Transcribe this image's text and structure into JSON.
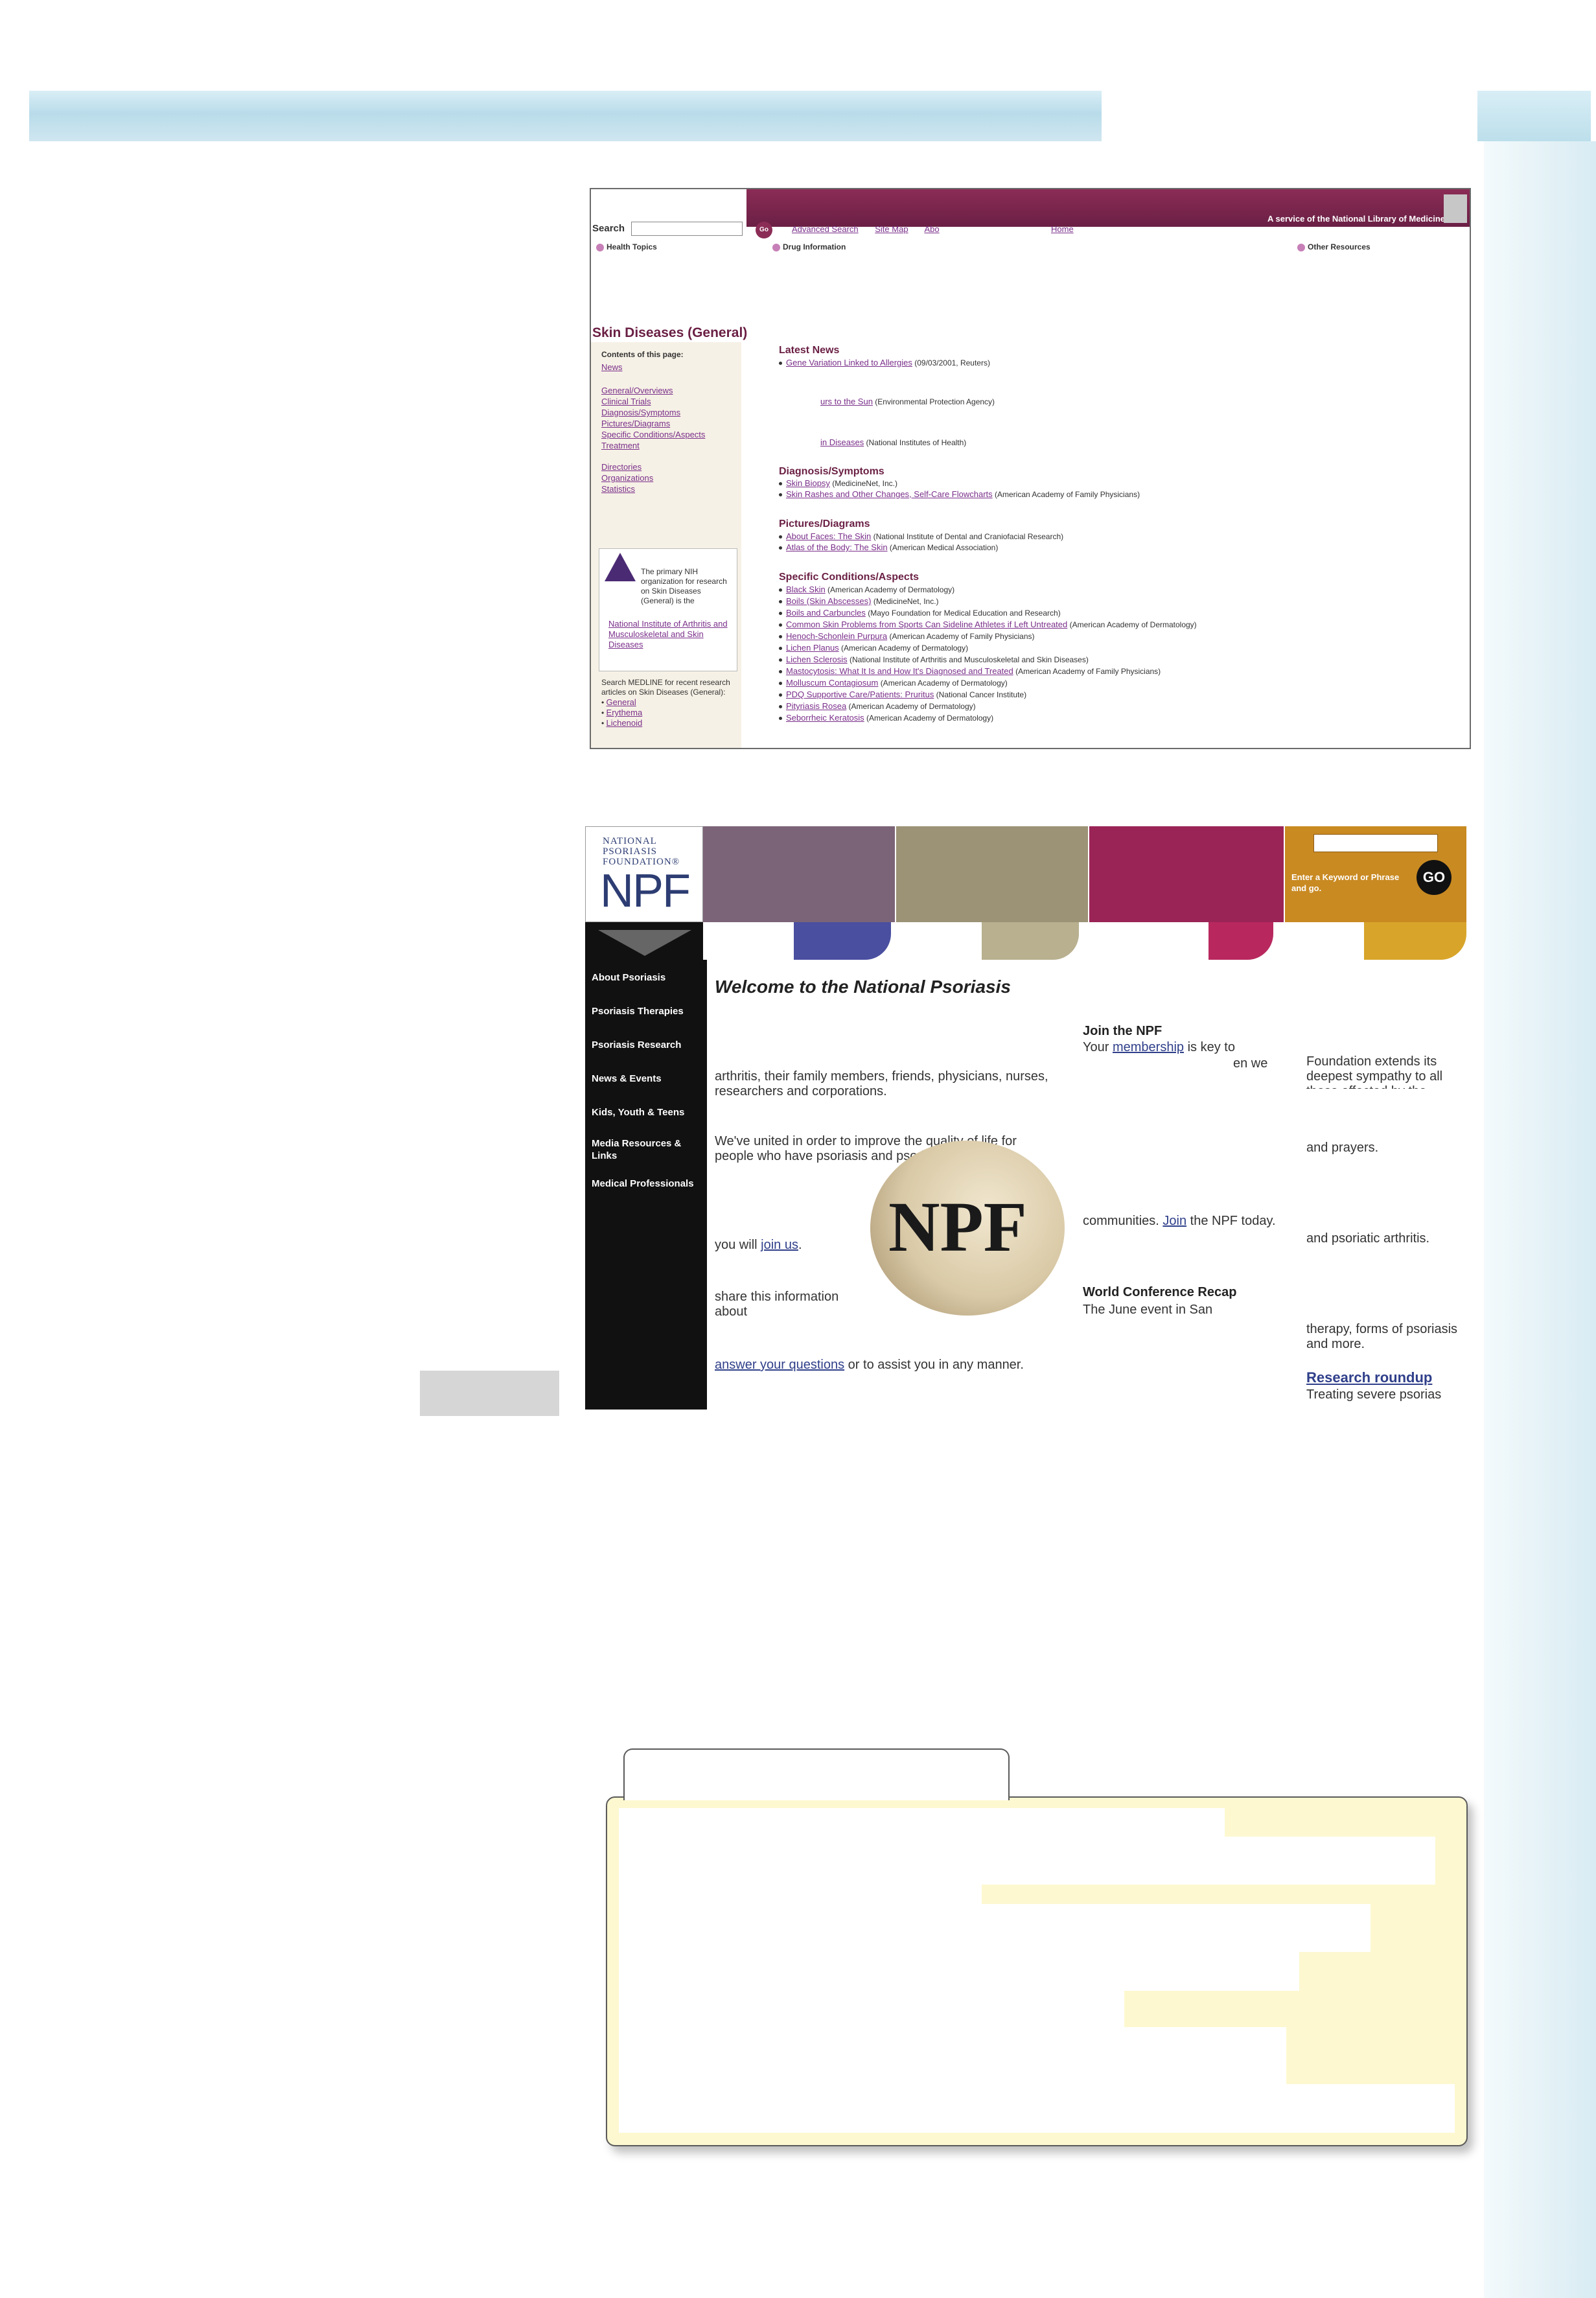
{
  "medline": {
    "banner_text": "A service of the National Library of Medicine",
    "search_label": "Search",
    "go_label": "Go",
    "nav_links": [
      "Advanced Search",
      "Site Map",
      "Abo"
    ],
    "home_link": "Home",
    "tabs": [
      "Health Topics",
      "Drug Information",
      "Other Resources"
    ],
    "page_title": "Skin Diseases (General)",
    "contents_label": "Contents of this page:",
    "side_links_1": [
      "News"
    ],
    "side_links_2": [
      "General/Overviews",
      "Clinical Trials",
      "Diagnosis/Symptoms",
      "Pictures/Diagrams",
      "Specific Conditions/Aspects",
      "Treatment"
    ],
    "side_links_3": [
      "Directories",
      "Organizations",
      "Statistics"
    ],
    "nih_text_1": "The primary NIH organization for research on Skin Diseases (General) is the",
    "nih_link": "National Institute of Arthritis and Musculoskeletal and Skin Diseases",
    "medline_text": "Search MEDLINE for recent research articles on Skin Diseases (General):",
    "medline_links": [
      "General",
      "Erythema",
      "Lichenoid"
    ],
    "sections": [
      {
        "heading": "Latest News",
        "items": [
          {
            "link": "Gene Variation Linked to Allergies",
            "src": "(09/03/2001, Reuters)"
          },
          {
            "link": "urs to the Sun",
            "src": "(Environmental Protection Agency)"
          },
          {
            "link": "in Diseases",
            "src": "(National Institutes of Health)"
          }
        ]
      },
      {
        "heading": "Diagnosis/Symptoms",
        "items": [
          {
            "link": "Skin Biopsy",
            "src": "(MedicineNet, Inc.)"
          },
          {
            "link": "Skin Rashes and Other Changes, Self-Care Flowcharts",
            "src": "(American Academy of Family Physicians)"
          }
        ]
      },
      {
        "heading": "Pictures/Diagrams",
        "items": [
          {
            "link": "About Faces: The Skin",
            "src": "(National Institute of Dental and Craniofacial Research)"
          },
          {
            "link": "Atlas of the Body: The Skin",
            "src": "(American Medical Association)"
          }
        ]
      },
      {
        "heading": "Specific Conditions/Aspects",
        "items": [
          {
            "link": "Black Skin",
            "src": "(American Academy of Dermatology)"
          },
          {
            "link": "Boils (Skin Abscesses)",
            "src": "(MedicineNet, Inc.)"
          },
          {
            "link": "Boils and Carbuncles",
            "src": "(Mayo Foundation for Medical Education and Research)"
          },
          {
            "link": "Common Skin Problems from Sports Can Sideline Athletes if Left Untreated",
            "src": "(American Academy of Dermatology)"
          },
          {
            "link": "Henoch-Schonlein Purpura",
            "src": "(American Academy of Family Physicians)"
          },
          {
            "link": "Lichen Planus",
            "src": "(American Academy of Dermatology)"
          },
          {
            "link": "Lichen Sclerosis",
            "src": "(National Institute of Arthritis and Musculoskeletal and Skin Diseases)"
          },
          {
            "link": "Mastocytosis: What It Is and How It's Diagnosed and Treated",
            "src": "(American Academy of Family Physicians)"
          },
          {
            "link": "Molluscum Contagiosum",
            "src": "(American Academy of Dermatology)"
          },
          {
            "link": "PDQ Supportive Care/Patients: Pruritus",
            "src": "(National Cancer Institute)"
          },
          {
            "link": "Pityriasis Rosea",
            "src": "(American Academy of Dermatology)"
          },
          {
            "link": "Seborrheic Keratosis",
            "src": "(American Academy of Dermatology)"
          }
        ]
      }
    ]
  },
  "npf": {
    "logo_small": "NATIONAL PSORIASIS FOUNDATION®",
    "logo_big": "NPF",
    "keyword_text": "Enter a Keyword or Phrase and go.",
    "go_label": "GO",
    "colors": {
      "purple": "#7c6478",
      "khaki": "#9c9276",
      "magenta": "#9b2456",
      "gold": "#c98a22",
      "blue": "#4a4fa0",
      "lightkhaki": "#b8b08f",
      "pink": "#b8285e",
      "yellow": "#d8a52a"
    },
    "nav_items": [
      "About Psoriasis",
      "Psoriasis Therapies",
      "Psoriasis Research",
      "News & Events",
      "Kids, Youth & Teens",
      "Media Resources & Links",
      "Medical Professionals"
    ],
    "welcome": "Welcome to the National Psoriasis",
    "body_1": "arthritis, their family members, friends, physicians, nurses, researchers and corporations.",
    "body_2": "We've united in order to improve the quality of life for people who have psoriasis and psoriatic arthritis, to",
    "body_3a": "you will",
    "body_3_link": "join us",
    "body_4": "share this information about",
    "body_5_link": "answer your questions",
    "body_5": "or to assist you in any manner.",
    "photo_text": "NPF",
    "join_heading": "Join the NPF",
    "join_text_1": "Your",
    "join_link": "membership",
    "join_text_2": "is key to",
    "join_text_3": "en we",
    "join_text_4": "communities.",
    "join_link_2": "Join",
    "join_text_5": "the NPF today.",
    "conference_heading": "World Conference Recap",
    "conference_text": "The June event in San",
    "col3_1": "Foundation extends its deepest sympathy to all those affected by the",
    "col3_2": "and prayers.",
    "col3_3": "and psoriatic arthritis.",
    "col3_4": "therapy, forms of psoriasis and more.",
    "research_heading": "Research roundup",
    "research_text": "Treating severe psorias"
  }
}
